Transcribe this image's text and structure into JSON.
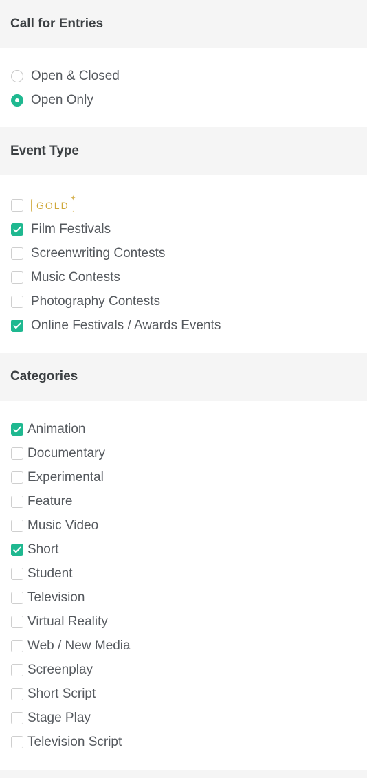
{
  "call_for_entries": {
    "title": "Call for Entries",
    "options": [
      {
        "label": "Open & Closed",
        "selected": false
      },
      {
        "label": "Open Only",
        "selected": true
      }
    ]
  },
  "event_type": {
    "title": "Event Type",
    "gold_badge": "GOLD",
    "gold_checked": false,
    "options": [
      {
        "label": "Film Festivals",
        "checked": true
      },
      {
        "label": "Screenwriting Contests",
        "checked": false
      },
      {
        "label": "Music Contests",
        "checked": false
      },
      {
        "label": "Photography Contests",
        "checked": false
      },
      {
        "label": "Online Festivals / Awards Events",
        "checked": true
      }
    ]
  },
  "categories": {
    "title": "Categories",
    "options": [
      {
        "label": "Animation",
        "checked": true
      },
      {
        "label": "Documentary",
        "checked": false
      },
      {
        "label": "Experimental",
        "checked": false
      },
      {
        "label": "Feature",
        "checked": false
      },
      {
        "label": "Music Video",
        "checked": false
      },
      {
        "label": "Short",
        "checked": true
      },
      {
        "label": "Student",
        "checked": false
      },
      {
        "label": "Television",
        "checked": false
      },
      {
        "label": "Virtual Reality",
        "checked": false
      },
      {
        "label": "Web / New Media",
        "checked": false
      },
      {
        "label": "Screenplay",
        "checked": false
      },
      {
        "label": "Short Script",
        "checked": false
      },
      {
        "label": "Stage Play",
        "checked": false
      },
      {
        "label": "Television Script",
        "checked": false
      }
    ]
  },
  "colors": {
    "accent": "#1fb890",
    "header_bg": "#f5f5f5",
    "gold": "#d7b456"
  },
  "icons": {
    "gold_sparkle": "sparkle-icon"
  }
}
